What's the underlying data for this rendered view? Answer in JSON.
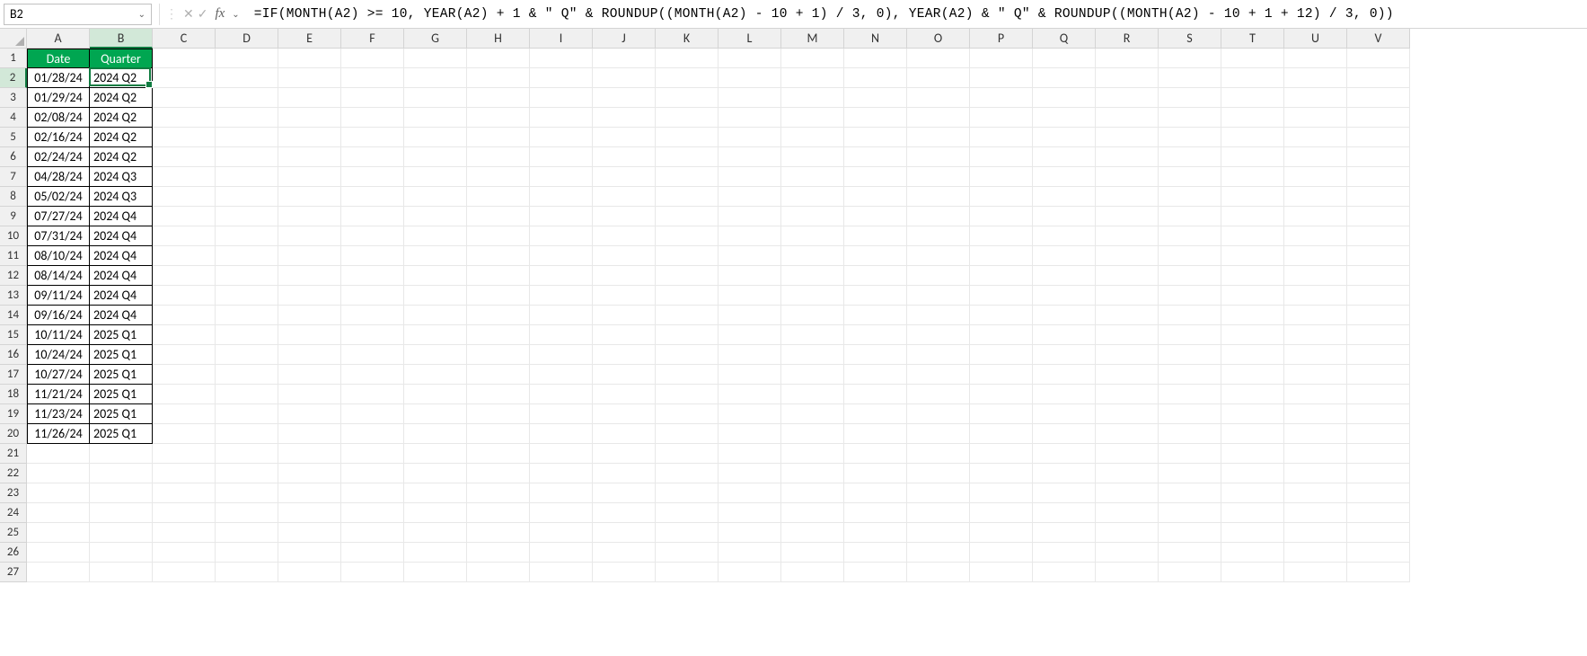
{
  "nameBox": "B2",
  "formula": "=IF(MONTH(A2) >= 10, YEAR(A2) + 1 & \" Q\" & ROUNDUP((MONTH(A2) - 10 + 1) / 3, 0), YEAR(A2) & \" Q\" & ROUNDUP((MONTH(A2) - 10 + 1 + 12) / 3, 0))",
  "columnLetters": [
    "A",
    "B",
    "C",
    "D",
    "E",
    "F",
    "G",
    "H",
    "I",
    "J",
    "K",
    "L",
    "M",
    "N",
    "O",
    "P",
    "Q",
    "R",
    "S",
    "T",
    "U",
    "V"
  ],
  "activeColumnIndex": 1,
  "activeRowIndex": 2,
  "visibleRowCount": 27,
  "headers": {
    "colA": "Date",
    "colB": "Quarter"
  },
  "rows": [
    {
      "date": "01/28/24",
      "quarter": "2024 Q2"
    },
    {
      "date": "01/29/24",
      "quarter": "2024 Q2"
    },
    {
      "date": "02/08/24",
      "quarter": "2024 Q2"
    },
    {
      "date": "02/16/24",
      "quarter": "2024 Q2"
    },
    {
      "date": "02/24/24",
      "quarter": "2024 Q2"
    },
    {
      "date": "04/28/24",
      "quarter": "2024 Q3"
    },
    {
      "date": "05/02/24",
      "quarter": "2024 Q3"
    },
    {
      "date": "07/27/24",
      "quarter": "2024 Q4"
    },
    {
      "date": "07/31/24",
      "quarter": "2024 Q4"
    },
    {
      "date": "08/10/24",
      "quarter": "2024 Q4"
    },
    {
      "date": "08/14/24",
      "quarter": "2024 Q4"
    },
    {
      "date": "09/11/24",
      "quarter": "2024 Q4"
    },
    {
      "date": "09/16/24",
      "quarter": "2024 Q4"
    },
    {
      "date": "10/11/24",
      "quarter": "2025 Q1"
    },
    {
      "date": "10/24/24",
      "quarter": "2025 Q1"
    },
    {
      "date": "10/27/24",
      "quarter": "2025 Q1"
    },
    {
      "date": "11/21/24",
      "quarter": "2025 Q1"
    },
    {
      "date": "11/23/24",
      "quarter": "2025 Q1"
    },
    {
      "date": "11/26/24",
      "quarter": "2025 Q1"
    }
  ],
  "fxLabel": "fx",
  "icons": {
    "cancel": "✕",
    "accept": "✓",
    "dropdown": "⌄"
  }
}
